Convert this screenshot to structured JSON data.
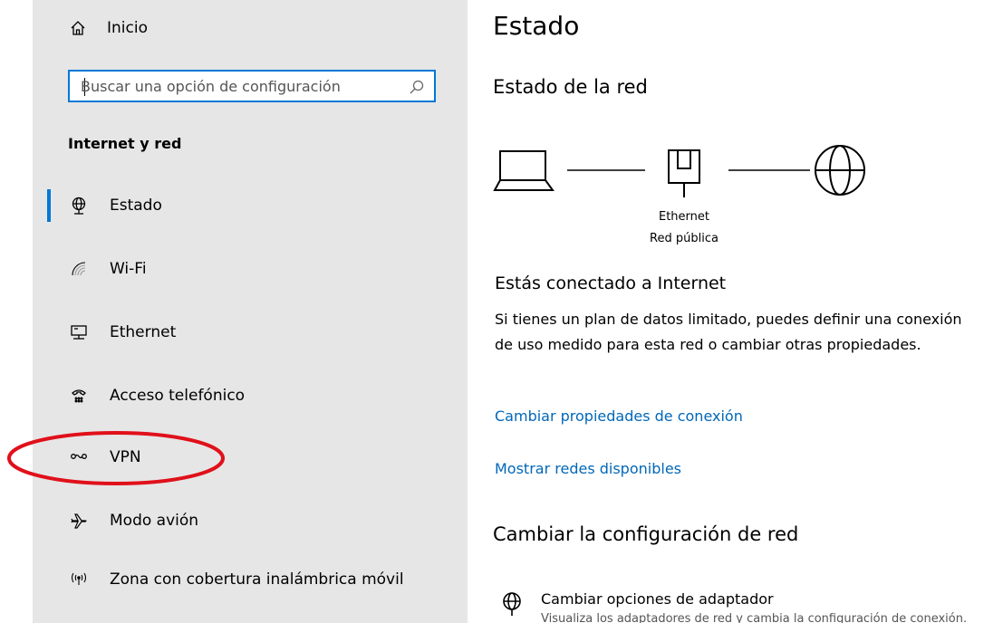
{
  "sidebar": {
    "home_label": "Inicio",
    "search": {
      "placeholder": "Buscar una opción de configuración",
      "value": ""
    },
    "section_title": "Internet y red",
    "items": [
      {
        "label": "Estado",
        "icon": "globe-network-icon",
        "active": true
      },
      {
        "label": "Wi-Fi",
        "icon": "wifi-icon"
      },
      {
        "label": "Ethernet",
        "icon": "ethernet-icon"
      },
      {
        "label": "Acceso telefónico",
        "icon": "dial-up-icon"
      },
      {
        "label": "VPN",
        "icon": "vpn-icon"
      },
      {
        "label": "Modo avión",
        "icon": "airplane-icon"
      },
      {
        "label": "Zona con cobertura inalámbrica móvil",
        "icon": "hotspot-icon"
      }
    ]
  },
  "main": {
    "title": "Estado",
    "network_status_heading": "Estado de la red",
    "diagram": {
      "adapter_name": "Ethernet",
      "network_type": "Red pública"
    },
    "connected_heading": "Estás conectado a Internet",
    "connected_desc": "Si tienes un plan de datos limitado, puedes definir una conexión de uso medido para esta red o cambiar otras propiedades.",
    "link_change_properties": "Cambiar propiedades de conexión",
    "link_show_networks": "Mostrar redes disponibles",
    "change_settings_heading": "Cambiar la configuración de red",
    "adapter_option": {
      "title": "Cambiar opciones de adaptador",
      "desc": "Visualiza los adaptadores de red y cambia la configuración de conexión."
    }
  },
  "colors": {
    "accent": "#0078d7",
    "link": "#0067b8",
    "sidebar_bg": "#e6e6e6",
    "annotation_red": "#e0101a"
  }
}
